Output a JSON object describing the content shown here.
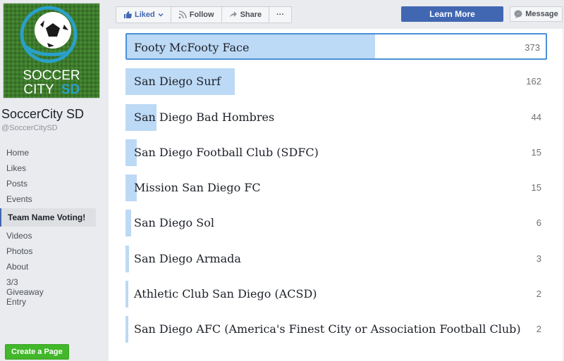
{
  "page": {
    "name": "SoccerCity SD",
    "handle": "@SoccerCitySD",
    "logo_text_top": "SOCCER",
    "logo_text_bottom_a": "CITY",
    "logo_text_bottom_b": "SD"
  },
  "nav": [
    {
      "label": "Home",
      "active": false
    },
    {
      "label": "Likes",
      "active": false
    },
    {
      "label": "Posts",
      "active": false
    },
    {
      "label": "Events",
      "active": false
    },
    {
      "label": "Team Name Voting!",
      "active": true
    },
    {
      "label": "Videos",
      "active": false
    },
    {
      "label": "Photos",
      "active": false
    },
    {
      "label": "About",
      "active": false
    },
    {
      "label": "3/3 Giveaway Entry",
      "active": false
    }
  ],
  "create_page_label": "Create a Page",
  "toolbar": {
    "liked_label": "Liked",
    "follow_label": "Follow",
    "share_label": "Share",
    "more_label": "···",
    "learn_more_label": "Learn More",
    "message_label": "Message"
  },
  "poll": {
    "max_votes": 373,
    "options": [
      {
        "label": "Footy McFooty Face",
        "votes": 373
      },
      {
        "label": "San Diego Surf",
        "votes": 162
      },
      {
        "label": "San Diego Bad Hombres",
        "votes": 44
      },
      {
        "label": "San Diego Football Club (SDFC)",
        "votes": 15
      },
      {
        "label": "Mission San Diego FC",
        "votes": 15
      },
      {
        "label": "San Diego Sol",
        "votes": 6
      },
      {
        "label": "San Diego Armada",
        "votes": 3
      },
      {
        "label": "Athletic Club San Diego (ACSD)",
        "votes": 2
      },
      {
        "label": "San Diego AFC (America's Finest City or Association Football Club)",
        "votes": 2
      }
    ]
  },
  "colors": {
    "accent": "#4267b2",
    "bar": "#bcd9f5",
    "selected_border": "#4a90d9",
    "create_page": "#42b72a"
  }
}
